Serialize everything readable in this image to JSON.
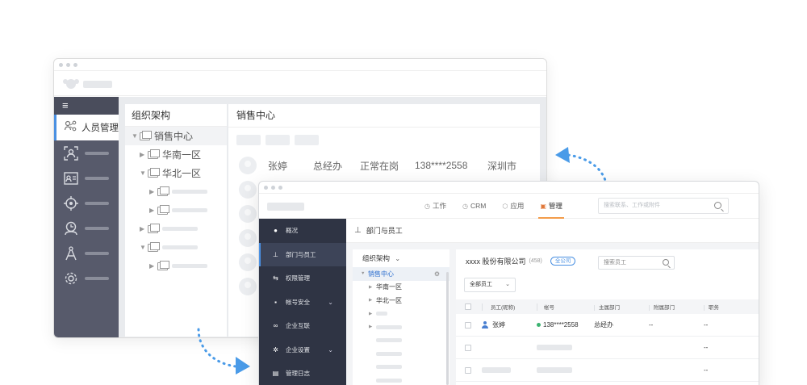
{
  "back_window": {
    "sidebar": {
      "menu_icon": "hamburger-icon",
      "active_item": {
        "icon": "people-share-icon",
        "label": "人员管理"
      },
      "items": [
        {
          "icon": "person-scan-icon"
        },
        {
          "icon": "id-card-icon"
        },
        {
          "icon": "crosshair-icon"
        },
        {
          "icon": "clock-user-icon"
        },
        {
          "icon": "compass-pen-icon"
        },
        {
          "icon": "gear-icon"
        }
      ]
    },
    "tree": {
      "title": "组织架构",
      "nodes": [
        "销售中心",
        "华南一区",
        "华北一区"
      ]
    },
    "main": {
      "title": "销售中心",
      "person": {
        "name": "张婷",
        "title": "总经办",
        "status": "正常在岗",
        "phone": "138****2558",
        "city": "深圳市"
      }
    }
  },
  "front_window": {
    "nav": [
      {
        "icon": "clock-icon",
        "label": "工作"
      },
      {
        "icon": "clock-icon",
        "label": "CRM"
      },
      {
        "icon": "cube-icon",
        "label": "应用"
      },
      {
        "icon": "chart-icon",
        "label": "管理",
        "active": true
      }
    ],
    "search_placeholder": "搜索联系、工作或附件",
    "sidebar": [
      {
        "icon": "info-icon",
        "label": "概况"
      },
      {
        "icon": "org-tree-icon",
        "label": "部门与员工",
        "active": true
      },
      {
        "icon": "key-icon",
        "label": "权限管理"
      },
      {
        "icon": "lock-icon",
        "label": "帐号安全",
        "expand": true
      },
      {
        "icon": "infinity-icon",
        "label": "企业互联"
      },
      {
        "icon": "gear-icon",
        "label": "企业设置",
        "expand": true
      },
      {
        "icon": "log-icon",
        "label": "管理日志"
      }
    ],
    "breadcrumb": "部门与员工",
    "tree": {
      "title": "组织架构",
      "nodes": [
        "销售中心",
        "华南一区",
        "华北一区"
      ]
    },
    "company": {
      "name": "xxxx  股份有限公司",
      "count": "(458)",
      "badge": "全公司"
    },
    "employee_search_placeholder": "搜索员工",
    "filter": "全部员工",
    "table": {
      "headers": [
        "员工(昵称)",
        "帐号",
        "主属部门",
        "附属部门",
        "职务"
      ],
      "rows": [
        {
          "name": "张婷",
          "account": "138****2558",
          "dept": "总经办",
          "sub_dept": "--",
          "role": "--"
        }
      ],
      "placeholder_roles": [
        "--",
        "--"
      ]
    },
    "accent": "#4a90e2"
  }
}
